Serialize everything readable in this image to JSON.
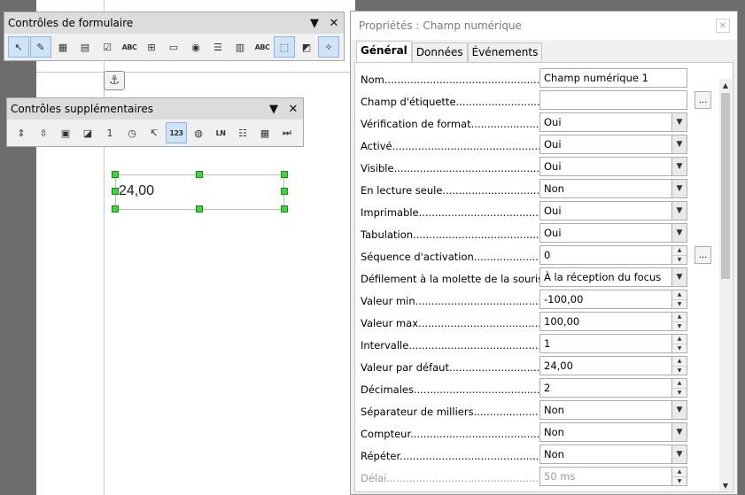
{
  "form_toolbar": {
    "title": "Contrôles de formulaire",
    "icons": [
      "select-icon",
      "design-mode-icon",
      "control-wizards-icon",
      "form-design-icon",
      "checkbox-icon",
      "text-box-icon",
      "formatted-field-icon",
      "push-button-icon",
      "option-button-icon",
      "list-box-icon",
      "combo-box-icon",
      "label-field-icon",
      "group-box-icon",
      "form-properties-icon",
      "more-controls-icon"
    ],
    "text_glyphs": {
      "text_box": "ABC",
      "label_field": "ABC"
    }
  },
  "extra_toolbar": {
    "title": "Contrôles supplémentaires",
    "icons": [
      "spin-button-icon",
      "scrollbar-icon",
      "image-button-icon",
      "image-control-icon",
      "date-field-icon",
      "time-field-icon",
      "file-selection-icon",
      "numeric-field-icon",
      "currency-field-icon",
      "pattern-field-icon",
      "group-box-icon",
      "table-control-icon",
      "navigation-bar-icon"
    ],
    "numeric_glyph": "123",
    "date_glyph": "1",
    "pattern_glyph": "LN"
  },
  "document": {
    "field_value": "24,00"
  },
  "dialog": {
    "title": "Propriétés : Champ numérique",
    "close_glyph": "✕",
    "tabs": [
      {
        "label": "Général",
        "active": true
      },
      {
        "label": "Données",
        "active": false
      },
      {
        "label": "Événements",
        "active": false
      }
    ],
    "properties": [
      {
        "label": "Nom",
        "value": "Champ numérique 1",
        "type": "text"
      },
      {
        "label": "Champ d'étiquette",
        "value": "",
        "type": "text-button"
      },
      {
        "label": "Vérification de format",
        "value": "Oui",
        "type": "dropdown"
      },
      {
        "label": "Activé",
        "value": "Oui",
        "type": "dropdown"
      },
      {
        "label": "Visible",
        "value": "Oui",
        "type": "dropdown"
      },
      {
        "label": "En lecture seule",
        "value": "Non",
        "type": "dropdown"
      },
      {
        "label": "Imprimable",
        "value": "Oui",
        "type": "dropdown"
      },
      {
        "label": "Tabulation",
        "value": "Oui",
        "type": "dropdown"
      },
      {
        "label": "Séquence d'activation",
        "value": "0",
        "type": "spin-button"
      },
      {
        "label": "Défilement à la molette de la souris",
        "value": "À la réception du focus",
        "type": "dropdown"
      },
      {
        "label": "Valeur min",
        "value": "-100,00",
        "type": "spin"
      },
      {
        "label": "Valeur max",
        "value": "100,00",
        "type": "spin"
      },
      {
        "label": "Intervalle",
        "value": "1",
        "type": "spin"
      },
      {
        "label": "Valeur par défaut",
        "value": "24,00",
        "type": "spin"
      },
      {
        "label": "Décimales",
        "value": "2",
        "type": "spin"
      },
      {
        "label": "Séparateur de milliers",
        "value": "Non",
        "type": "dropdown"
      },
      {
        "label": "Compteur",
        "value": "Non",
        "type": "dropdown"
      },
      {
        "label": "Répéter",
        "value": "Non",
        "type": "dropdown"
      },
      {
        "label": "Délai",
        "value": "50 ms",
        "type": "spin",
        "disabled": true
      }
    ],
    "ellipsis_label": "..."
  },
  "colors": {
    "handle_fill": "#3bd83b",
    "active_icon_bg": "#cfe3f6",
    "titlebar_bg": "#dcdcdc",
    "workspace_bg": "#6d6d6d"
  }
}
